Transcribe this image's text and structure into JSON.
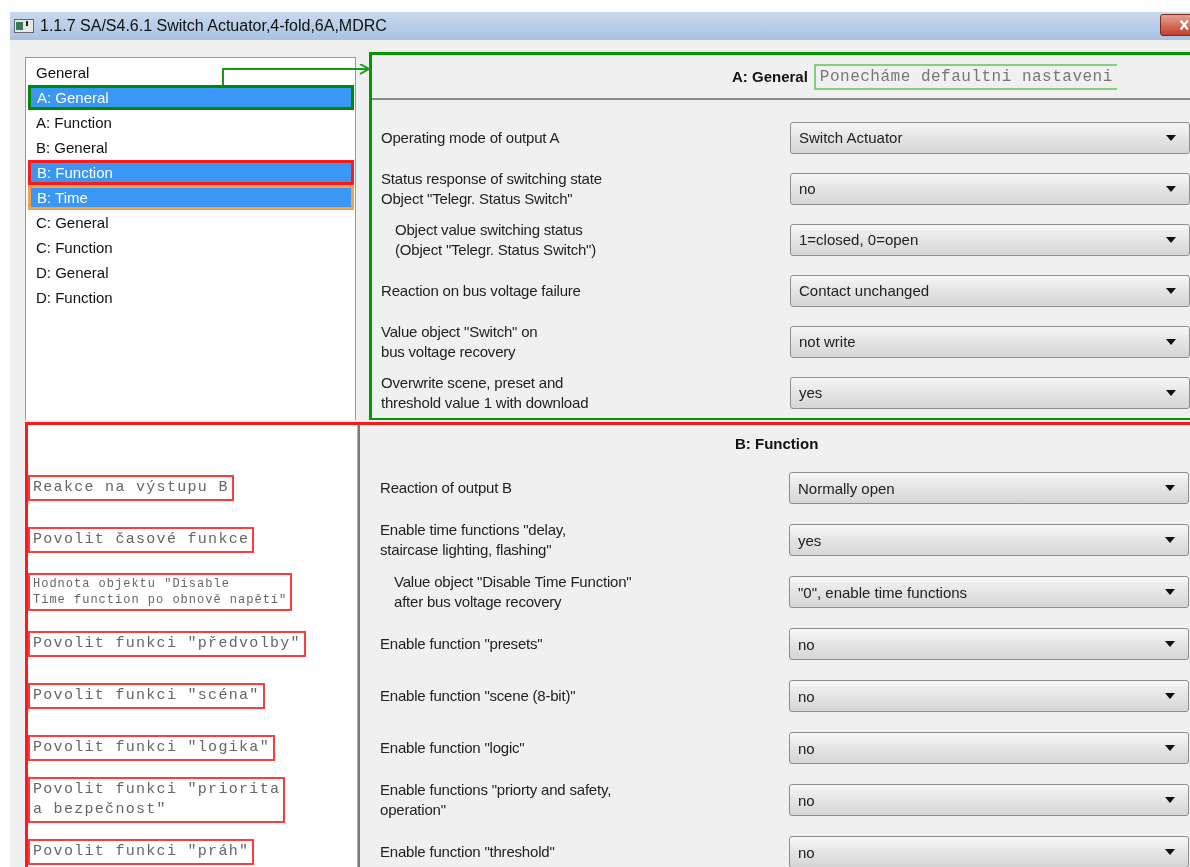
{
  "window": {
    "title": "1.1.7 SA/S4.6.1 Switch Actuator,4-fold,6A,MDRC"
  },
  "tree": {
    "items": [
      {
        "label": "General",
        "selected": false
      },
      {
        "label": "A: General",
        "selected": true,
        "color": "#008a00"
      },
      {
        "label": "A: Function",
        "selected": false
      },
      {
        "label": "B: General",
        "selected": false
      },
      {
        "label": "B: Function",
        "selected": true,
        "color": "#ff1a1a"
      },
      {
        "label": "B: Time",
        "selected": true,
        "color": "#f5a04a"
      },
      {
        "label": "C: General",
        "selected": false
      },
      {
        "label": "C: Function",
        "selected": false
      },
      {
        "label": "D: General",
        "selected": false
      },
      {
        "label": "D: Function",
        "selected": false
      }
    ]
  },
  "sections": [
    {
      "title": "A: General",
      "color": "#009900",
      "note": "Ponecháme defaultni nastaveni",
      "params": [
        {
          "label": "Operating mode of output A",
          "value": "Switch Actuator"
        },
        {
          "label": "Status response of switching state\nObject \"Telegr. Status Switch\"",
          "value": "no",
          "children": [
            {
              "label": "Object value switching status\n(Object \"Telegr. Status Switch\")",
              "value": "1=closed, 0=open"
            }
          ]
        },
        {
          "label": "Reaction on bus voltage failure",
          "value": "Contact unchanged"
        },
        {
          "label": "Value object \"Switch\" on\nbus voltage recovery",
          "value": "not write"
        },
        {
          "label": "Overwrite scene, preset and\nthreshold value 1 with download",
          "value": "yes"
        }
      ]
    },
    {
      "title": "B: Function",
      "color": "#ff1a1a",
      "params": [
        {
          "label": "Reaction of output B",
          "value": "Normally open",
          "annotation": "Reakce na výstupu B"
        },
        {
          "label": "Enable time functions \"delay,\nstaircase lighting, flashing\"",
          "value": "yes",
          "annotation": "Povolit časové funkce",
          "children": [
            {
              "label": "Value object \"Disable Time Function\"\nafter bus voltage recovery",
              "value": "\"0\", enable time functions",
              "annotation": "Hodnota objektu \"Disable\nTime function po obnově napětí\""
            }
          ]
        },
        {
          "label": "Enable function \"presets\"",
          "value": "no",
          "annotation": "Povolit funkci \"předvolby\""
        },
        {
          "label": "Enable function \"scene (8-bit)\"",
          "value": "no",
          "annotation": "Povolit funkci \"scéna\""
        },
        {
          "label": "Enable function \"logic\"",
          "value": "no",
          "annotation": "Povolit funkci \"logika\""
        },
        {
          "label": "Enable functions \"priorty and safety,\noperation\"",
          "value": "no",
          "annotation": "Povolit funkci \"priorita\na bezpečnost\""
        },
        {
          "label": "Enable function \"threshold\"",
          "value": "no",
          "annotation": "Povolit funkci \"práh\""
        }
      ]
    }
  ]
}
